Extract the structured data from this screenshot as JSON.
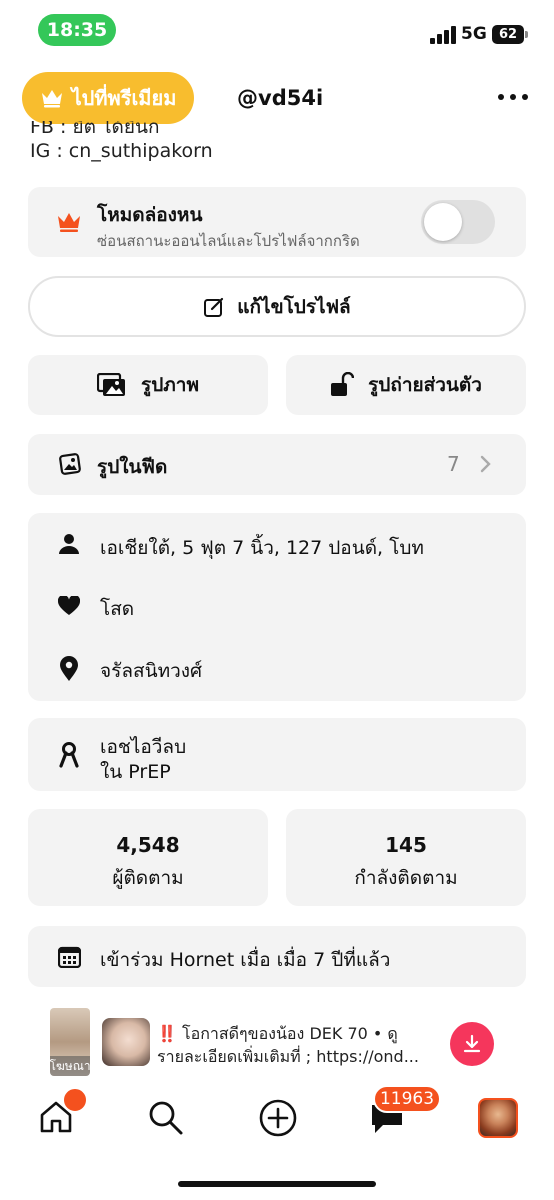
{
  "status_bar": {
    "time": "18:35",
    "network": "5G",
    "battery": "62"
  },
  "header": {
    "premium_label": "ไปที่พรีเมียม",
    "username": "@vd54i"
  },
  "bio": {
    "partial_line": "FB : ยิต ได้ยินก",
    "ig_line": "IG : cn_suthipakorn"
  },
  "incognito": {
    "title": "โหมดล่องหน",
    "subtitle": "ซ่อนสถานะออนไลน์และโปรไฟล์จากกริด",
    "enabled": false
  },
  "edit_profile": {
    "label": "แก้ไขโปรไฟล์"
  },
  "photos": {
    "public_label": "รูปภาพ",
    "private_label": "รูปถ่ายส่วนตัว"
  },
  "feed_photos": {
    "label": "รูปในฟีด",
    "count": "7"
  },
  "details": {
    "stats": "เอเชียใต้, 5 ฟุต 7 นิ้ว, 127 ปอนด์, โบท",
    "relationship": "โสด",
    "location": "จรัลสนิทวงศ์"
  },
  "hiv": {
    "status": "เอชไอวีลบ",
    "prep": "ใน PrEP"
  },
  "counts": {
    "followers_value": "4,548",
    "followers_label": "ผู้ติดตาม",
    "following_value": "145",
    "following_label": "กำลังติดตาม"
  },
  "joined": {
    "label": "เข้าร่วม Hornet เมื่อ เมื่อ 7 ปีที่แล้ว"
  },
  "ad": {
    "tag": "โฆษณา",
    "line1": "‼️ โอกาสดีๆของน้อง DEK 70  • ดู",
    "line2": "รายละเอียดเพิ่มเติมที่ ; https://ond..."
  },
  "tab_bar": {
    "messages_badge": "11963"
  },
  "colors": {
    "accent": "#f4511e",
    "premium": "#f8bd2e",
    "status_green": "#34c759",
    "download": "#f5365c"
  }
}
